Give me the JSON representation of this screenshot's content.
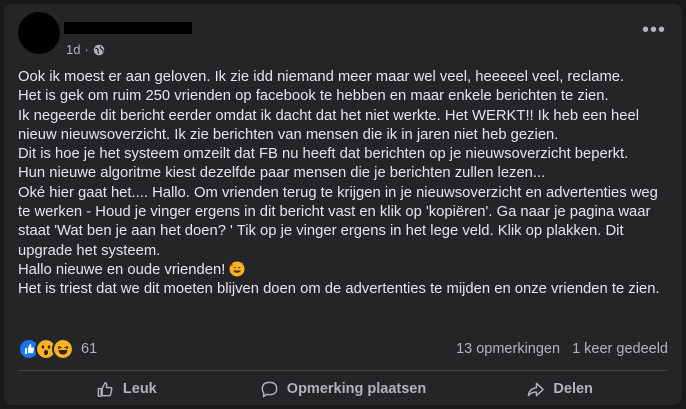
{
  "post": {
    "time": "1d",
    "separator": "·",
    "lines": [
      "Ook ik moest er aan geloven. Ik zie idd niemand meer maar wel veel, heeeeel veel, reclame.",
      "Het is gek om ruim 250 vrienden op facebook te hebben en maar enkele berichten te zien.",
      "Ik negeerde dit bericht eerder omdat ik dacht dat het niet werkte. Het WERKT!! Ik heb een heel nieuw nieuwsoverzicht. Ik zie berichten van mensen die ik in jaren niet heb gezien.",
      "Dit is hoe je het systeem omzeilt dat FB nu heeft dat berichten op je nieuwsoverzicht beperkt.",
      "Hun nieuwe algoritme kiest dezelfde paar mensen die je berichten zullen lezen...",
      "Oké hier gaat het.... Hallo. Om vrienden terug te krijgen in je nieuwsoverzicht en advertenties weg te werken - Houd je vinger ergens in dit bericht vast en klik op 'kopiëren'. Ga naar je pagina waar staat 'Wat ben je aan het doen? ' Tik op je vinger ergens in het lege veld. Klik op plakken. Dit upgrade het systeem.",
      "Hallo nieuwe en oude vrienden!",
      "Het is triest dat we dit moeten blijven doen om de advertenties te mijden en onze vrienden te zien."
    ]
  },
  "stats": {
    "reaction_count": "61",
    "comments": "13 opmerkingen",
    "shares": "1 keer gedeeld"
  },
  "actions": {
    "like": "Leuk",
    "comment": "Opmerking plaatsen",
    "share": "Delen"
  },
  "colors": {
    "background": "#242526",
    "text": "#e4e6eb",
    "secondary": "#b0b3b8",
    "like_blue": "#1877f2",
    "wow_yellow": "#f7b125"
  }
}
